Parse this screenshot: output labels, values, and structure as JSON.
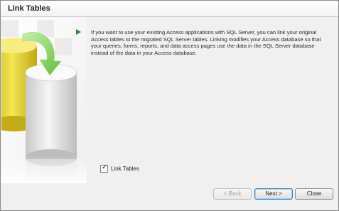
{
  "window": {
    "title": "Link Tables"
  },
  "art": {
    "icon": "database-migration-art"
  },
  "content": {
    "play_icon": "play-icon",
    "description": "If you want to use your existing Access applications with SQL Server, you can link your original Access tables to the migrated SQL Server tables. Linking modifies your Access database so that your queries, forms, reports, and data access pages use the data in the SQL Server database instead of the data in your Access database.",
    "link_tables_checkbox": {
      "label": "Link Tables",
      "checked": true
    }
  },
  "buttons": {
    "back_label": "< Back",
    "next_label": "Next >",
    "close_label": "Close"
  },
  "colors": {
    "arrow_green": "#2e8b2e",
    "db_yellow": "#e8d83a",
    "window_bg": "#f0f0f0"
  }
}
